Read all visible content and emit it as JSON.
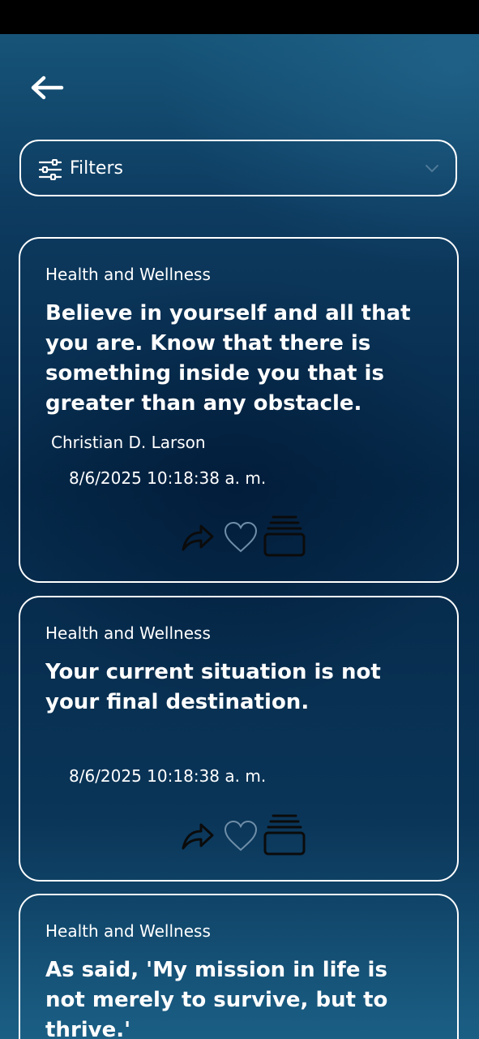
{
  "filters": {
    "label": "Filters"
  },
  "quotes": [
    {
      "category": "Health and Wellness",
      "text": "Believe in yourself and all that you are. Know that there is something inside you that is greater than any obstacle.",
      "author": "Christian D. Larson",
      "date": "8/6/2025 10:18:38 a. m."
    },
    {
      "category": "Health and Wellness",
      "text": "Your current situation is not your final destination.",
      "author": "",
      "date": "8/6/2025 10:18:38 a. m."
    },
    {
      "category": "Health and Wellness",
      "text": "As  said, 'My mission in life is not merely to survive, but to thrive.'"
    }
  ],
  "icons": {
    "back": "arrow-left-icon",
    "filters": "sliders-icon",
    "dropdown": "chevron-down-icon",
    "share": "share-icon",
    "like": "heart-icon",
    "save": "stack-icon"
  },
  "colors": {
    "accent": "#ffffff",
    "icon_dark": "#0b0b0b",
    "heart_outline": "#6f8ea8"
  }
}
